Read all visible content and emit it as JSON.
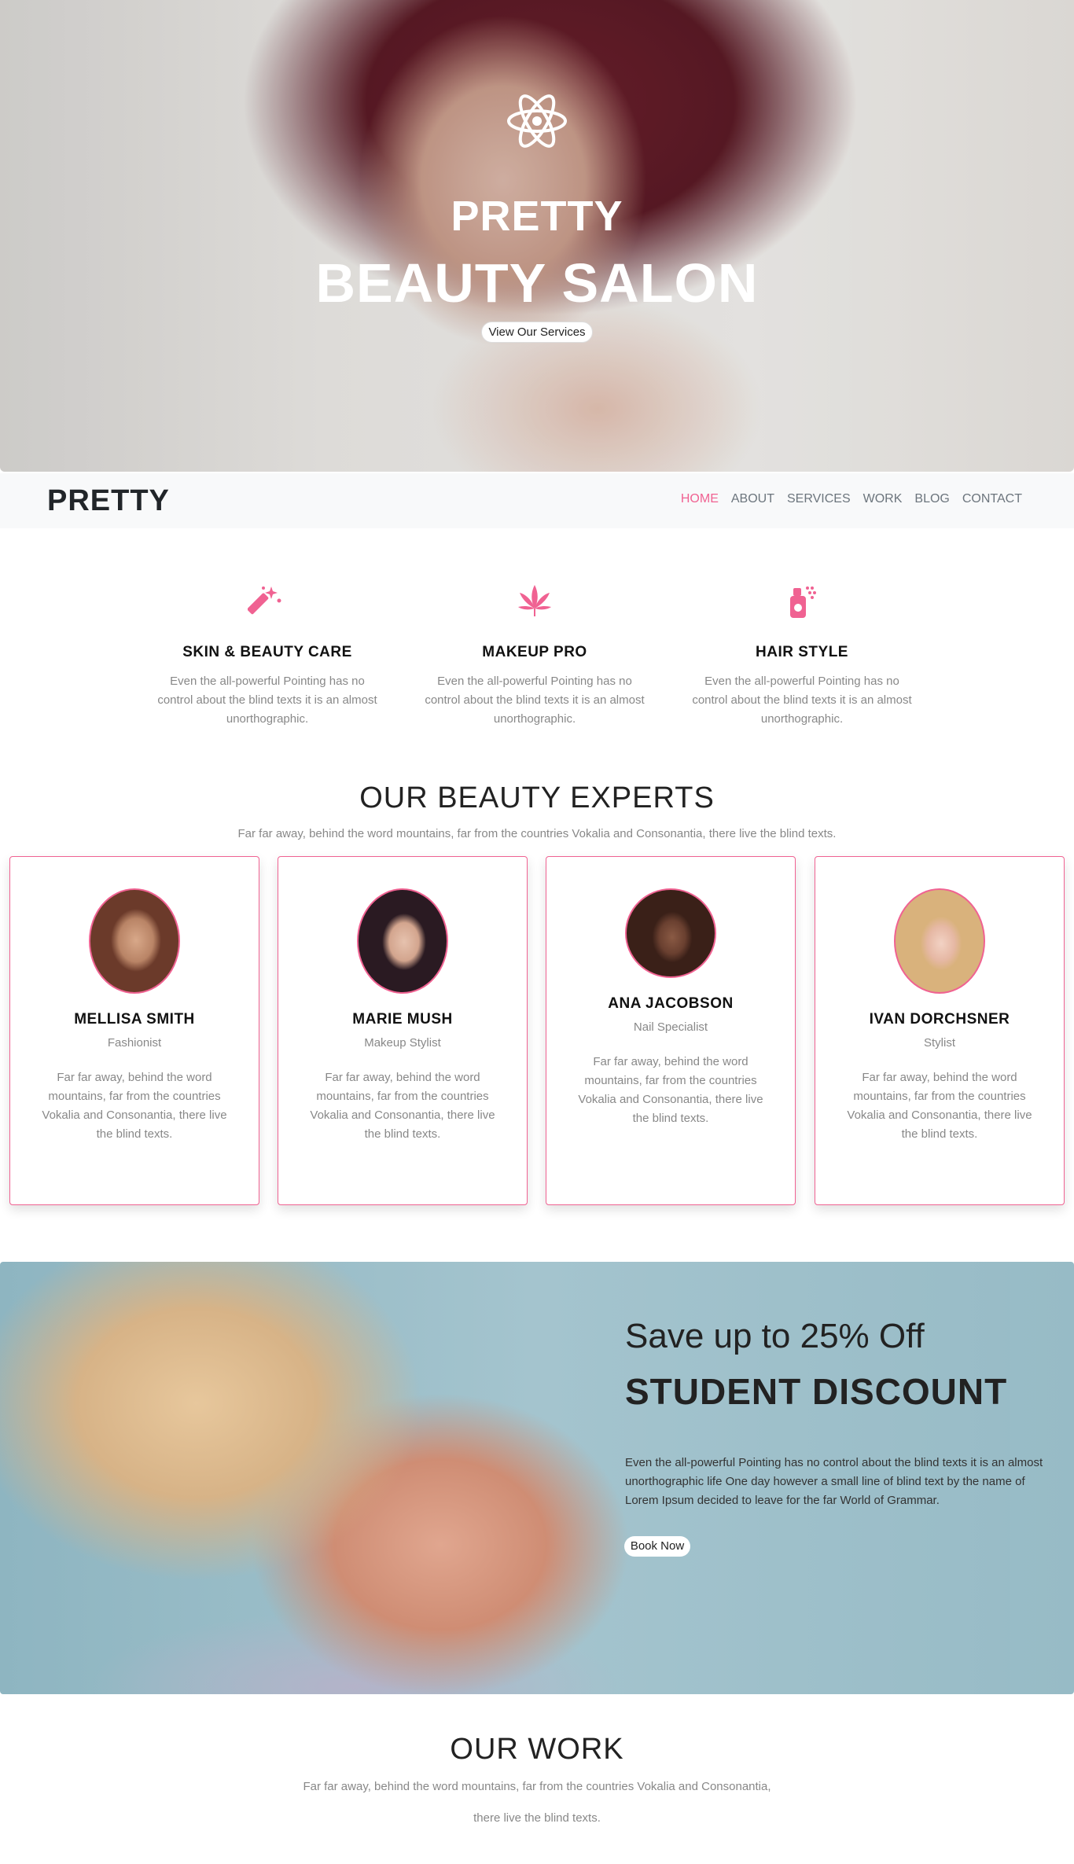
{
  "hero": {
    "line1": "PRETTY",
    "line2": "BEAUTY SALON",
    "button": "View Our Services",
    "logo_icon": "atom-icon"
  },
  "navbar": {
    "brand": "PRETTY",
    "items": [
      {
        "label": "HOME",
        "active": true
      },
      {
        "label": "ABOUT",
        "active": false
      },
      {
        "label": "SERVICES",
        "active": false
      },
      {
        "label": "WORK",
        "active": false
      },
      {
        "label": "BLOG",
        "active": false
      },
      {
        "label": "CONTACT",
        "active": false
      }
    ]
  },
  "services": [
    {
      "icon": "magic-wand-icon",
      "title": "SKIN & BEAUTY CARE",
      "text": "Even the all-powerful Pointing has no control about the blind texts it is an almost unorthographic."
    },
    {
      "icon": "leaf-icon",
      "title": "MAKEUP PRO",
      "text": "Even the all-powerful Pointing has no control about the blind texts it is an almost unorthographic."
    },
    {
      "icon": "spray-bottle-icon",
      "title": "HAIR STYLE",
      "text": "Even the all-powerful Pointing has no control about the blind texts it is an almost unorthographic."
    }
  ],
  "experts": {
    "title": "OUR BEAUTY EXPERTS",
    "subtitle": "Far far away, behind the word mountains, far from the countries Vokalia and Consonantia, there live the blind texts.",
    "members": [
      {
        "name": "MELLISA SMITH",
        "role": "Fashionist",
        "text": "Far far away, behind the word mountains, far from the countries Vokalia and Consonantia, there live the blind texts."
      },
      {
        "name": "MARIE MUSH",
        "role": "Makeup Stylist",
        "text": "Far far away, behind the word mountains, far from the countries Vokalia and Consonantia, there live the blind texts."
      },
      {
        "name": "ANA JACOBSON",
        "role": "Nail Specialist",
        "text": "Far far away, behind the word mountains, far from the countries Vokalia and Consonantia, there live the blind texts."
      },
      {
        "name": "IVAN DORCHSNER",
        "role": "Stylist",
        "text": "Far far away, behind the word mountains, far from the countries Vokalia and Consonantia, there live the blind texts."
      }
    ]
  },
  "discount": {
    "subtitle": "Save up to 25% Off",
    "title": "STUDENT DISCOUNT",
    "text": "Even the all-powerful Pointing has no control about the blind texts it is an almost unorthographic life One day however a small line of blind text by the name of Lorem Ipsum decided to leave for the far World of Grammar.",
    "button": "Book Now"
  },
  "work": {
    "title": "OUR WORK",
    "subtitle_line1": "Far far away, behind the word mountains, far from the countries Vokalia and Consonantia,",
    "subtitle_line2": "there live the blind texts."
  },
  "colors": {
    "accent": "#f06292",
    "muted_text": "#888888"
  }
}
